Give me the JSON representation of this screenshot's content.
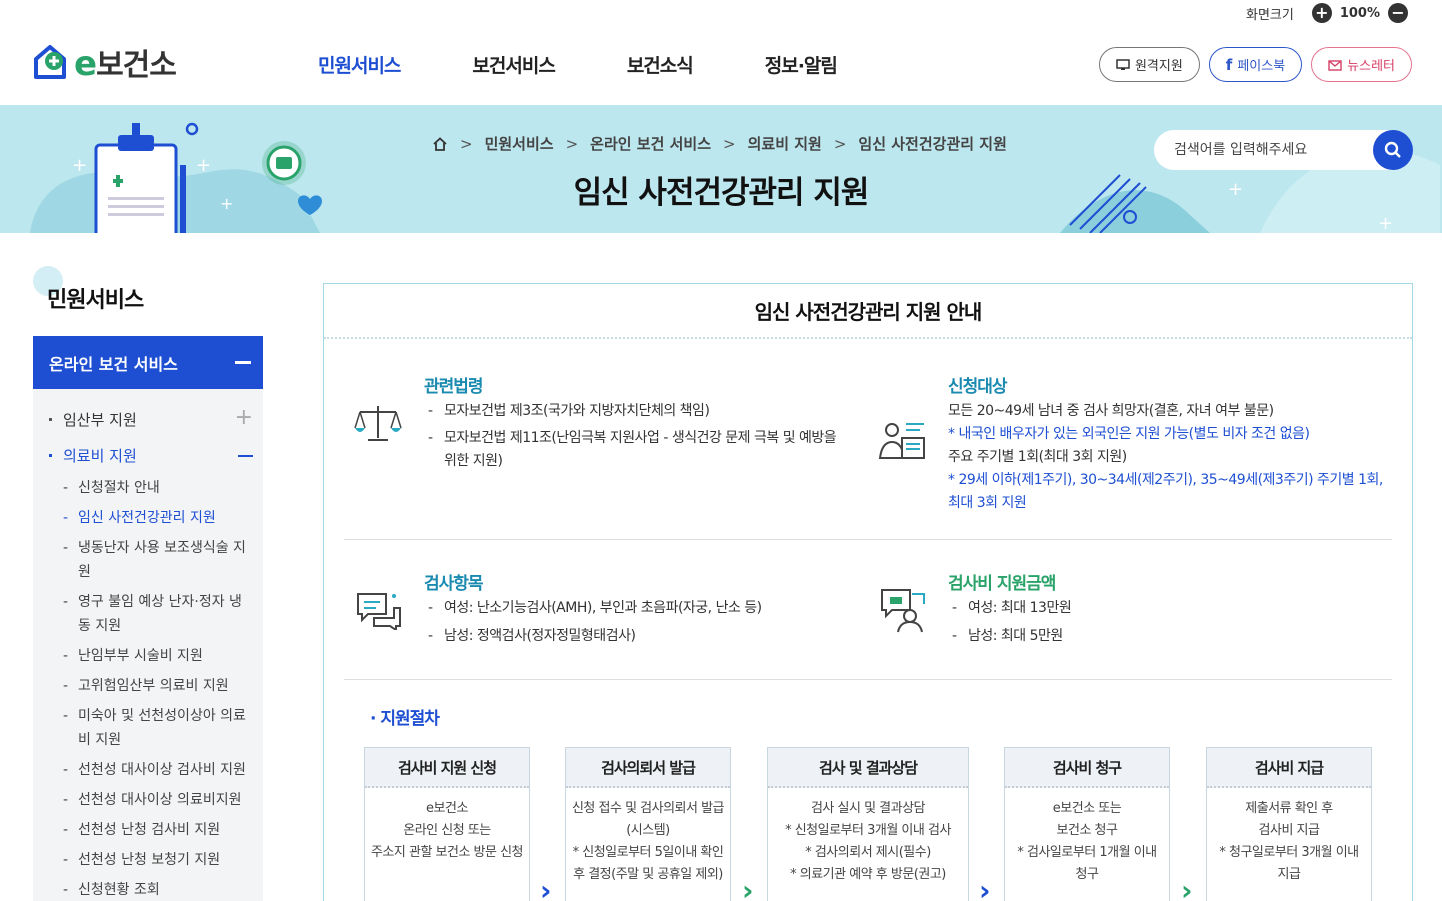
{
  "util": {
    "label": "화면크기",
    "zoom": "100%",
    "plus": "+",
    "minus": "−"
  },
  "header": {
    "logo_e": "e",
    "logo_text": "보건소",
    "nav": [
      "민원서비스",
      "보건서비스",
      "보건소식",
      "정보·알림"
    ],
    "buttons": {
      "remote": "원격지원",
      "facebook": "페이스북",
      "newsletter": "뉴스레터"
    }
  },
  "banner": {
    "breadcrumb": [
      "민원서비스",
      "온라인 보건 서비스",
      "의료비 지원",
      "임신 사전건강관리 지원"
    ],
    "title": "임신 사전건강관리 지원",
    "search_placeholder": "검색어를 입력해주세요"
  },
  "sidebar": {
    "title": "민원서비스",
    "head": "온라인 보건 서비스",
    "level1": [
      "임산부 지원",
      "의료비 지원"
    ],
    "level2": [
      "신청절차 안내",
      "임신 사전건강관리 지원",
      "냉동난자 사용 보조생식술 지원",
      "영구 불임 예상 난자·정자 냉동 지원",
      "난임부부 시술비 지원",
      "고위험임산부 의료비 지원",
      "미숙아 및 선천성이상아 의료비 지원",
      "선천성 대사이상 검사비 지원",
      "선천성 대사이상 의료비지원",
      "선천성 난청 검사비 지원",
      "선천성 난청 보청기 지원",
      "신청현황 조회"
    ]
  },
  "main": {
    "title": "임신 사전건강관리 지원 안내",
    "law": {
      "heading": "관련법령",
      "items": [
        "모자보건법 제3조(국가와 지방자치단체의 책임)",
        "모자보건법 제11조(난임극복 지원사업 - 생식건강 문제 극복 및 예방을 위한 지원)"
      ]
    },
    "target": {
      "heading": "신청대상",
      "line1": "모든 20~49세 남녀 중 검사 희망자(결혼, 자녀 여부 불문)",
      "note1": "* 내국인 배우자가 있는 외국인은 지원 가능(별도 비자 조건 없음)",
      "line2": "주요 주기별 1회(최대 3회 지원)",
      "note2": "* 29세 이하(제1주기), 30~34세(제2주기), 35~49세(제3주기) 주기별 1회, 최대 3회 지원"
    },
    "tests": {
      "heading": "검사항목",
      "items": [
        "여성: 난소기능검사(AMH), 부인과 초음파(자궁, 난소 등)",
        "남성: 정액검사(정자정밀형태검사)"
      ]
    },
    "amount": {
      "heading": "검사비 지원금액",
      "items": [
        "여성: 최대 13만원",
        "남성: 최대 5만원"
      ]
    },
    "process": {
      "title": "· 지원절차",
      "steps": [
        {
          "title": "검사비 지원 신청",
          "lines": [
            "e보건소",
            "온라인 신청 또는",
            "주소지 관할 보건소 방문 신청"
          ]
        },
        {
          "title": "검사의뢰서 발급",
          "lines": [
            "신청 접수 및 검사의뢰서 발급",
            "(시스템)",
            "* 신청일로부터 5일이내 확인",
            "후 결정(주말 및 공휴일 제외)"
          ]
        },
        {
          "title": "검사 및 결과상담",
          "lines": [
            "검사 실시 및 결과상담",
            "* 신청일로부터 3개월 이내 검사",
            "* 검사의뢰서 제시(필수)",
            "* 의료기관 예약 후 방문(권고)"
          ]
        },
        {
          "title": "검사비 청구",
          "lines": [
            "e보건소 또는",
            "보건소 청구",
            "* 검사일로부터 1개월 이내",
            "청구"
          ]
        },
        {
          "title": "검사비 지급",
          "lines": [
            "제출서류 확인 후",
            "검사비 지급",
            "* 청구일로부터 3개월 이내",
            "지급"
          ]
        }
      ],
      "arrow": "›"
    }
  },
  "colors": {
    "primary": "#1e4fd3",
    "banner": "#bde7ee",
    "teal": "#1a8ab0",
    "green": "#2aa36a"
  }
}
